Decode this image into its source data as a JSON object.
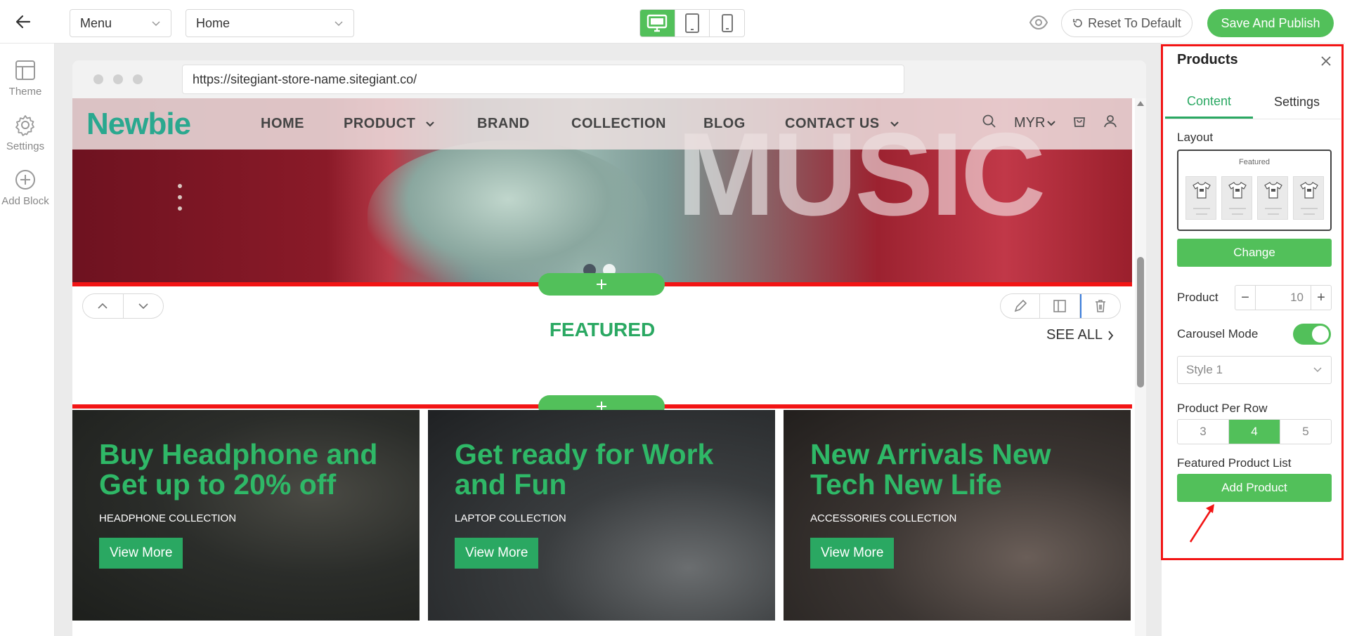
{
  "topbar": {
    "menu_select": "Menu",
    "page_select": "Home",
    "reset_label": "Reset To Default",
    "publish_label": "Save And Publish"
  },
  "sidebar": {
    "items": [
      {
        "label": "Theme",
        "icon": "layout-icon"
      },
      {
        "label": "Settings",
        "icon": "gear-icon"
      },
      {
        "label": "Add Block",
        "icon": "plus-circle-icon"
      }
    ]
  },
  "browser": {
    "url": "https://sitegiant-store-name.sitegiant.co/"
  },
  "store": {
    "logo": "Newbie",
    "nav": [
      "HOME",
      "PRODUCT",
      "BRAND",
      "COLLECTION",
      "BLOG",
      "CONTACT US"
    ],
    "currency": "MYR",
    "hero_text": "MUSIC"
  },
  "featured": {
    "title": "FEATURED",
    "see_all": "SEE ALL"
  },
  "banners": [
    {
      "title": "Buy Headphone and Get up to 20% off",
      "subtitle": "HEADPHONE COLLECTION",
      "button": "View More"
    },
    {
      "title": "Get ready for Work and Fun",
      "subtitle": "LAPTOP COLLECTION",
      "button": "View More"
    },
    {
      "title": "New Arrivals New Tech New Life",
      "subtitle": "ACCESSORIES COLLECTION",
      "button": "View More"
    }
  ],
  "panel": {
    "title": "Products",
    "tabs": [
      "Content",
      "Settings"
    ],
    "layout_label": "Layout",
    "layout_preview_title": "Featured",
    "change_label": "Change",
    "product_label": "Product",
    "product_value": "10",
    "carousel_label": "Carousel Mode",
    "carousel_on": true,
    "style_value": "Style 1",
    "per_row_label": "Product Per Row",
    "per_row_options": [
      "3",
      "4",
      "5"
    ],
    "per_row_selected": "4",
    "featured_list_label": "Featured Product List",
    "add_product_label": "Add Product"
  },
  "colors": {
    "accent": "#52c05a",
    "brand_green": "#2aa862",
    "highlight_red": "#f21414"
  }
}
